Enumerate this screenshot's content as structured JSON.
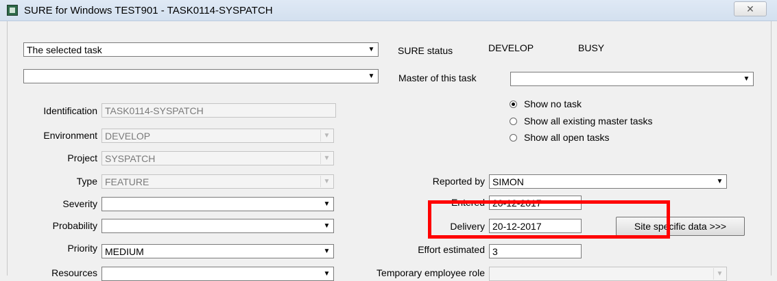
{
  "window": {
    "title": "SURE for Windows TEST901 - TASK0114-SYSPATCH",
    "close_glyph": "✕",
    "icon": "app-icon"
  },
  "top": {
    "selector1_value": "The selected task",
    "selector2_value": "",
    "sure_status_label": "SURE status",
    "sure_status_env": "DEVELOP",
    "sure_status_state": "BUSY",
    "master_label": "Master of this task",
    "master_value": ""
  },
  "radios": [
    {
      "label": "Show no task",
      "checked": true
    },
    {
      "label": "Show all existing master tasks",
      "checked": false
    },
    {
      "label": "Show all open tasks",
      "checked": false
    }
  ],
  "fields": {
    "identification": {
      "label": "Identification",
      "value": "TASK0114-SYSPATCH"
    },
    "environment": {
      "label": "Environment",
      "value": "DEVELOP"
    },
    "project": {
      "label": "Project",
      "value": "SYSPATCH"
    },
    "type": {
      "label": "Type",
      "value": "FEATURE"
    },
    "severity": {
      "label": "Severity",
      "value": ""
    },
    "probability": {
      "label": "Probability",
      "value": ""
    },
    "priority": {
      "label": "Priority",
      "value": "MEDIUM"
    },
    "resources": {
      "label": "Resources",
      "value": ""
    }
  },
  "right_fields": {
    "reported_by": {
      "label": "Reported by",
      "value": "SIMON"
    },
    "entered": {
      "label": "Entered",
      "value": "20-12-2017"
    },
    "delivery": {
      "label": "Delivery",
      "value": "20-12-2017"
    },
    "effort_estimated": {
      "label": "Effort estimated",
      "value": "3"
    },
    "temp_employee_role": {
      "label": "Temporary employee role",
      "value": ""
    }
  },
  "buttons": {
    "site_specific": "Site specific data >>>"
  },
  "colors": {
    "highlight": "#ff0000"
  }
}
